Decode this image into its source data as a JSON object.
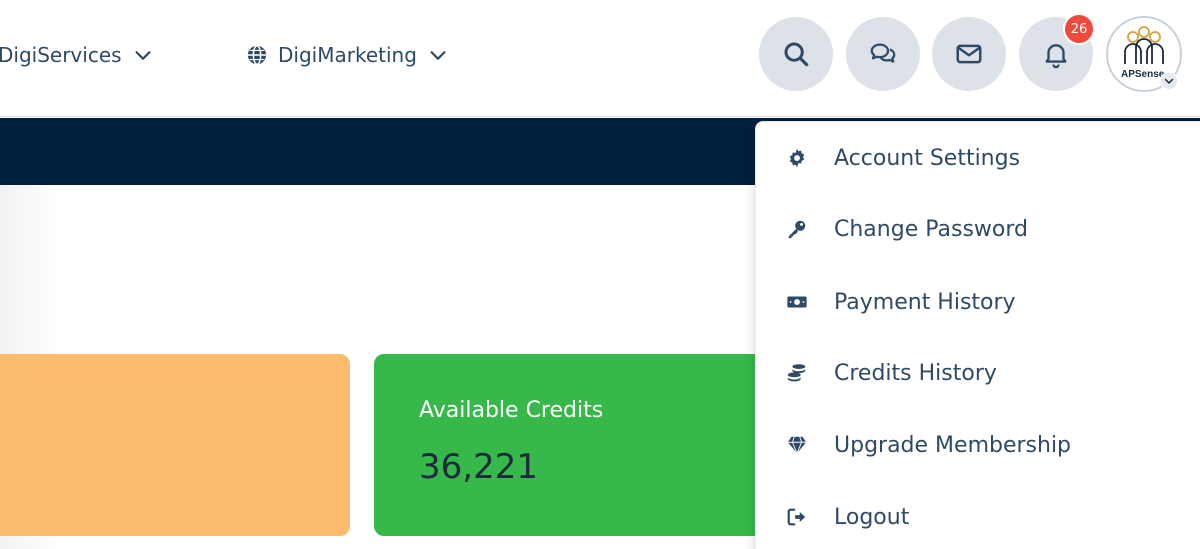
{
  "nav": {
    "items": [
      {
        "label": "DigiServices"
      },
      {
        "label": "DigiMarketing"
      }
    ]
  },
  "notifications": {
    "count": "26"
  },
  "avatar": {
    "brand_text": "APSense"
  },
  "cards": {
    "available_credits": {
      "label": "Available Credits",
      "value": "36,221"
    }
  },
  "account_menu": {
    "items": [
      {
        "label": "Account Settings",
        "icon": "gear-icon"
      },
      {
        "label": "Change Password",
        "icon": "key-icon"
      },
      {
        "label": "Payment History",
        "icon": "money-bill-icon"
      },
      {
        "label": "Credits History",
        "icon": "coins-icon"
      },
      {
        "label": "Upgrade Membership",
        "icon": "gem-icon"
      },
      {
        "label": "Logout",
        "icon": "sign-out-icon"
      }
    ]
  },
  "colors": {
    "navy_banner": "#00203f",
    "icon_button_bg": "#dde2e8",
    "badge_red": "#ef4b3c",
    "orange_card": "#fdbb6d",
    "green_card": "#36b84a",
    "text_primary": "#2f4a66"
  }
}
